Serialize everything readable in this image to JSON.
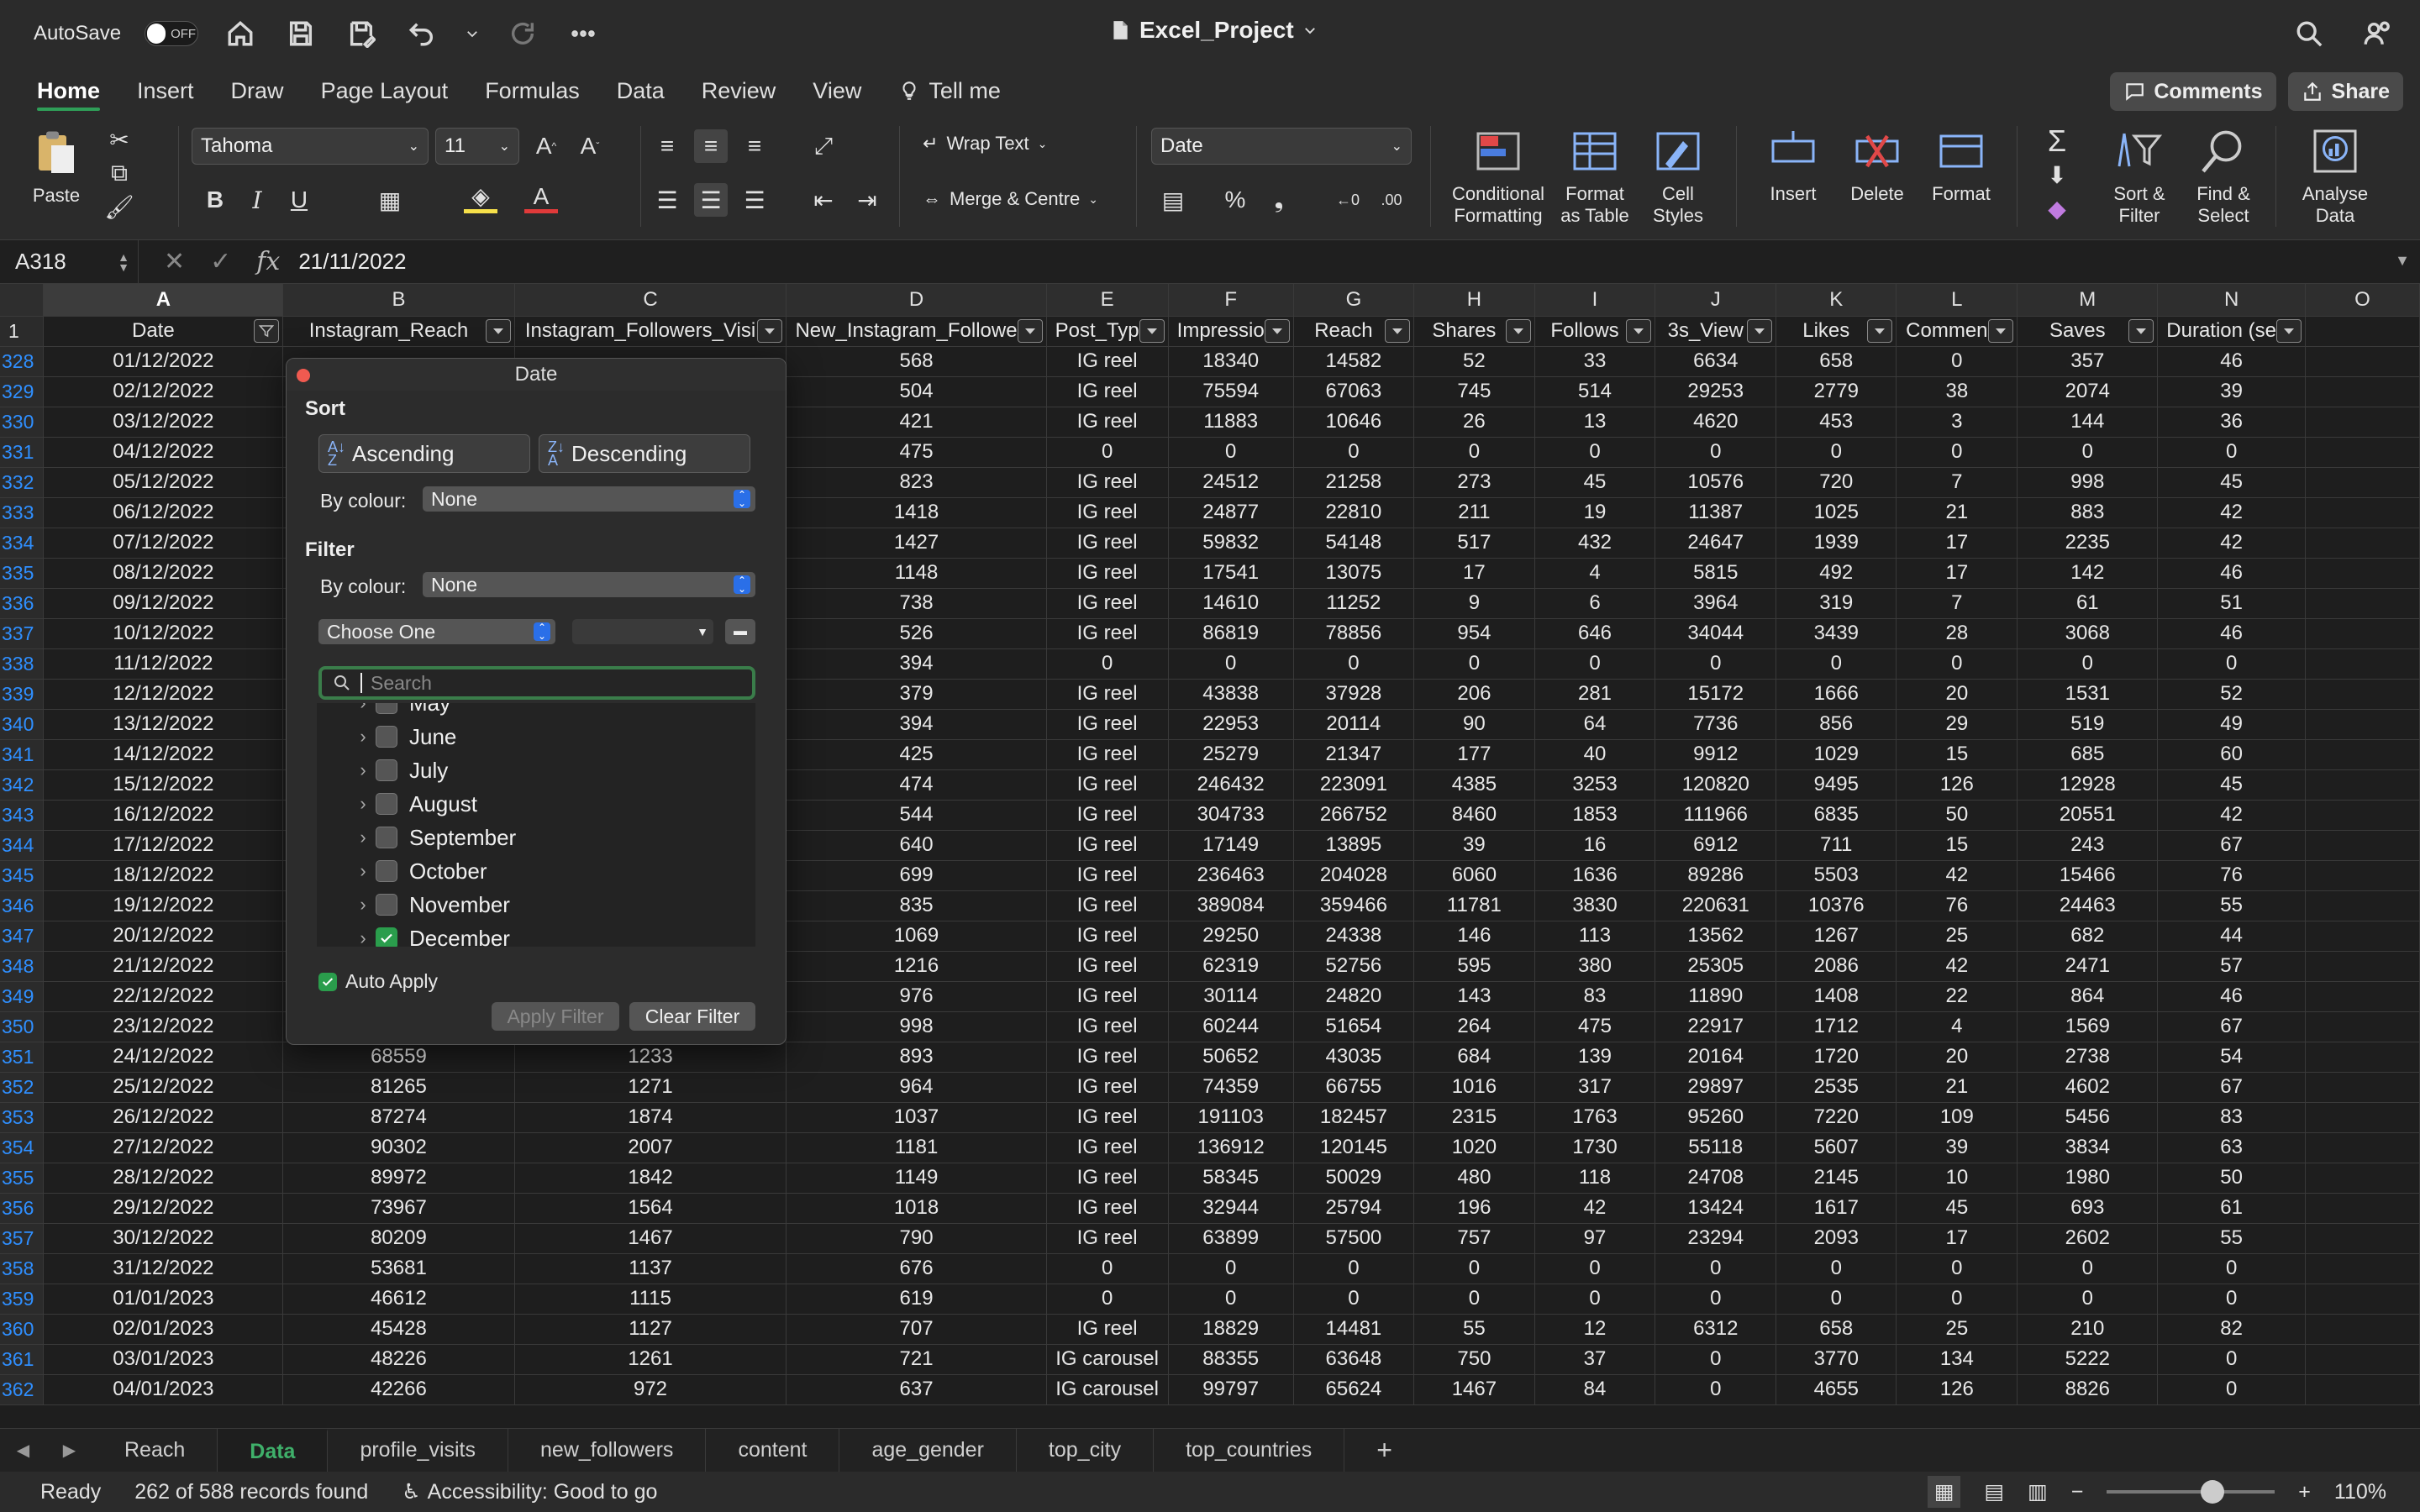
{
  "titlebar": {
    "autosave_label": "AutoSave",
    "autosave_state": "OFF",
    "doc_title": "Excel_Project"
  },
  "tabs": [
    "Home",
    "Insert",
    "Draw",
    "Page Layout",
    "Formulas",
    "Data",
    "Review",
    "View"
  ],
  "tell_me": "Tell me",
  "comments_label": "Comments",
  "share_label": "Share",
  "ribbon": {
    "paste": "Paste",
    "font_name": "Tahoma",
    "font_size": "11",
    "wrap_text": "Wrap Text",
    "merge_centre": "Merge & Centre",
    "number_format": "Date",
    "conditional_formatting": [
      "Conditional",
      "Formatting"
    ],
    "format_as_table": [
      "Format",
      "as Table"
    ],
    "cell_styles": [
      "Cell",
      "Styles"
    ],
    "insert": "Insert",
    "delete": "Delete",
    "format": "Format",
    "sort_filter": [
      "Sort &",
      "Filter"
    ],
    "find_select": [
      "Find &",
      "Select"
    ],
    "analyse_data": [
      "Analyse",
      "Data"
    ]
  },
  "formula_bar": {
    "name_box": "A318",
    "value": "21/11/2022"
  },
  "columns": [
    "A",
    "B",
    "C",
    "D",
    "E",
    "F",
    "G",
    "H",
    "I",
    "J",
    "K",
    "L",
    "M",
    "N",
    "O"
  ],
  "headers": [
    "Date",
    "Instagram_Reach",
    "Instagram_Followers_Visi",
    "New_Instagram_Followe",
    "Post_Typ",
    "Impressio",
    "Reach",
    "Shares",
    "Follows",
    "3s_View",
    "Likes",
    "Commen",
    "Saves",
    "Duration (se",
    ""
  ],
  "rows": [
    [
      "328",
      "01/12/2022",
      "",
      "",
      "568",
      "IG reel",
      "18340",
      "14582",
      "52",
      "33",
      "6634",
      "658",
      "0",
      "357",
      "46"
    ],
    [
      "329",
      "02/12/2022",
      "",
      "",
      "504",
      "IG reel",
      "75594",
      "67063",
      "745",
      "514",
      "29253",
      "2779",
      "38",
      "2074",
      "39"
    ],
    [
      "330",
      "03/12/2022",
      "",
      "",
      "421",
      "IG reel",
      "11883",
      "10646",
      "26",
      "13",
      "4620",
      "453",
      "3",
      "144",
      "36"
    ],
    [
      "331",
      "04/12/2022",
      "",
      "",
      "475",
      "0",
      "0",
      "0",
      "0",
      "0",
      "0",
      "0",
      "0",
      "0",
      "0"
    ],
    [
      "332",
      "05/12/2022",
      "",
      "",
      "823",
      "IG reel",
      "24512",
      "21258",
      "273",
      "45",
      "10576",
      "720",
      "7",
      "998",
      "45"
    ],
    [
      "333",
      "06/12/2022",
      "",
      "",
      "1418",
      "IG reel",
      "24877",
      "22810",
      "211",
      "19",
      "11387",
      "1025",
      "21",
      "883",
      "42"
    ],
    [
      "334",
      "07/12/2022",
      "",
      "",
      "1427",
      "IG reel",
      "59832",
      "54148",
      "517",
      "432",
      "24647",
      "1939",
      "17",
      "2235",
      "42"
    ],
    [
      "335",
      "08/12/2022",
      "",
      "",
      "1148",
      "IG reel",
      "17541",
      "13075",
      "17",
      "4",
      "5815",
      "492",
      "17",
      "142",
      "46"
    ],
    [
      "336",
      "09/12/2022",
      "",
      "",
      "738",
      "IG reel",
      "14610",
      "11252",
      "9",
      "6",
      "3964",
      "319",
      "7",
      "61",
      "51"
    ],
    [
      "337",
      "10/12/2022",
      "",
      "",
      "526",
      "IG reel",
      "86819",
      "78856",
      "954",
      "646",
      "34044",
      "3439",
      "28",
      "3068",
      "46"
    ],
    [
      "338",
      "11/12/2022",
      "",
      "",
      "394",
      "0",
      "0",
      "0",
      "0",
      "0",
      "0",
      "0",
      "0",
      "0",
      "0"
    ],
    [
      "339",
      "12/12/2022",
      "",
      "",
      "379",
      "IG reel",
      "43838",
      "37928",
      "206",
      "281",
      "15172",
      "1666",
      "20",
      "1531",
      "52"
    ],
    [
      "340",
      "13/12/2022",
      "",
      "",
      "394",
      "IG reel",
      "22953",
      "20114",
      "90",
      "64",
      "7736",
      "856",
      "29",
      "519",
      "49"
    ],
    [
      "341",
      "14/12/2022",
      "",
      "",
      "425",
      "IG reel",
      "25279",
      "21347",
      "177",
      "40",
      "9912",
      "1029",
      "15",
      "685",
      "60"
    ],
    [
      "342",
      "15/12/2022",
      "",
      "",
      "474",
      "IG reel",
      "246432",
      "223091",
      "4385",
      "3253",
      "120820",
      "9495",
      "126",
      "12928",
      "45"
    ],
    [
      "343",
      "16/12/2022",
      "",
      "",
      "544",
      "IG reel",
      "304733",
      "266752",
      "8460",
      "1853",
      "111966",
      "6835",
      "50",
      "20551",
      "42"
    ],
    [
      "344",
      "17/12/2022",
      "",
      "",
      "640",
      "IG reel",
      "17149",
      "13895",
      "39",
      "16",
      "6912",
      "711",
      "15",
      "243",
      "67"
    ],
    [
      "345",
      "18/12/2022",
      "",
      "",
      "699",
      "IG reel",
      "236463",
      "204028",
      "6060",
      "1636",
      "89286",
      "5503",
      "42",
      "15466",
      "76"
    ],
    [
      "346",
      "19/12/2022",
      "",
      "",
      "835",
      "IG reel",
      "389084",
      "359466",
      "11781",
      "3830",
      "220631",
      "10376",
      "76",
      "24463",
      "55"
    ],
    [
      "347",
      "20/12/2022",
      "",
      "",
      "1069",
      "IG reel",
      "29250",
      "24338",
      "146",
      "113",
      "13562",
      "1267",
      "25",
      "682",
      "44"
    ],
    [
      "348",
      "21/12/2022",
      "",
      "",
      "1216",
      "IG reel",
      "62319",
      "52756",
      "595",
      "380",
      "25305",
      "2086",
      "42",
      "2471",
      "57"
    ],
    [
      "349",
      "22/12/2022",
      "",
      "",
      "976",
      "IG reel",
      "30114",
      "24820",
      "143",
      "83",
      "11890",
      "1408",
      "22",
      "864",
      "46"
    ],
    [
      "350",
      "23/12/2022",
      "",
      "",
      "998",
      "IG reel",
      "60244",
      "51654",
      "264",
      "475",
      "22917",
      "1712",
      "4",
      "1569",
      "67"
    ],
    [
      "351",
      "24/12/2022",
      "68559",
      "1233",
      "893",
      "IG reel",
      "50652",
      "43035",
      "684",
      "139",
      "20164",
      "1720",
      "20",
      "2738",
      "54"
    ],
    [
      "352",
      "25/12/2022",
      "81265",
      "1271",
      "964",
      "IG reel",
      "74359",
      "66755",
      "1016",
      "317",
      "29897",
      "2535",
      "21",
      "4602",
      "67"
    ],
    [
      "353",
      "26/12/2022",
      "87274",
      "1874",
      "1037",
      "IG reel",
      "191103",
      "182457",
      "2315",
      "1763",
      "95260",
      "7220",
      "109",
      "5456",
      "83"
    ],
    [
      "354",
      "27/12/2022",
      "90302",
      "2007",
      "1181",
      "IG reel",
      "136912",
      "120145",
      "1020",
      "1730",
      "55118",
      "5607",
      "39",
      "3834",
      "63"
    ],
    [
      "355",
      "28/12/2022",
      "89972",
      "1842",
      "1149",
      "IG reel",
      "58345",
      "50029",
      "480",
      "118",
      "24708",
      "2145",
      "10",
      "1980",
      "50"
    ],
    [
      "356",
      "29/12/2022",
      "73967",
      "1564",
      "1018",
      "IG reel",
      "32944",
      "25794",
      "196",
      "42",
      "13424",
      "1617",
      "45",
      "693",
      "61"
    ],
    [
      "357",
      "30/12/2022",
      "80209",
      "1467",
      "790",
      "IG reel",
      "63899",
      "57500",
      "757",
      "97",
      "23294",
      "2093",
      "17",
      "2602",
      "55"
    ],
    [
      "358",
      "31/12/2022",
      "53681",
      "1137",
      "676",
      "0",
      "0",
      "0",
      "0",
      "0",
      "0",
      "0",
      "0",
      "0",
      "0"
    ],
    [
      "359",
      "01/01/2023",
      "46612",
      "1115",
      "619",
      "0",
      "0",
      "0",
      "0",
      "0",
      "0",
      "0",
      "0",
      "0",
      "0"
    ],
    [
      "360",
      "02/01/2023",
      "45428",
      "1127",
      "707",
      "IG reel",
      "18829",
      "14481",
      "55",
      "12",
      "6312",
      "658",
      "25",
      "210",
      "82"
    ],
    [
      "361",
      "03/01/2023",
      "48226",
      "1261",
      "721",
      "IG carousel",
      "88355",
      "63648",
      "750",
      "37",
      "0",
      "3770",
      "134",
      "5222",
      "0"
    ],
    [
      "362",
      "04/01/2023",
      "42266",
      "972",
      "637",
      "IG carousel",
      "99797",
      "65624",
      "1467",
      "84",
      "0",
      "4655",
      "126",
      "8826",
      "0"
    ]
  ],
  "filter_popup": {
    "title": "Date",
    "sort_label": "Sort",
    "ascending": "Ascending",
    "descending": "Descending",
    "by_colour_label": "By colour:",
    "sort_colour_value": "None",
    "filter_label": "Filter",
    "filter_colour_value": "None",
    "choose_one": "Choose One",
    "search_placeholder": "Search",
    "months": [
      {
        "label": "May",
        "checked": false
      },
      {
        "label": "June",
        "checked": false
      },
      {
        "label": "July",
        "checked": false
      },
      {
        "label": "August",
        "checked": false
      },
      {
        "label": "September",
        "checked": false
      },
      {
        "label": "October",
        "checked": false
      },
      {
        "label": "November",
        "checked": false
      },
      {
        "label": "December",
        "checked": true
      }
    ],
    "auto_apply": "Auto Apply",
    "apply_filter": "Apply Filter",
    "clear_filter": "Clear Filter"
  },
  "sheet_tabs": [
    "Reach",
    "Data",
    "profile_visits",
    "new_followers",
    "content",
    "age_gender",
    "top_city",
    "top_countries"
  ],
  "active_sheet": "Data",
  "status": {
    "ready": "Ready",
    "records": "262 of 588 records found",
    "accessibility": "Accessibility: Good to go",
    "zoom": "110%"
  },
  "colors": {
    "accent_green": "#2f9e58",
    "row_blue": "#2f8fff"
  }
}
